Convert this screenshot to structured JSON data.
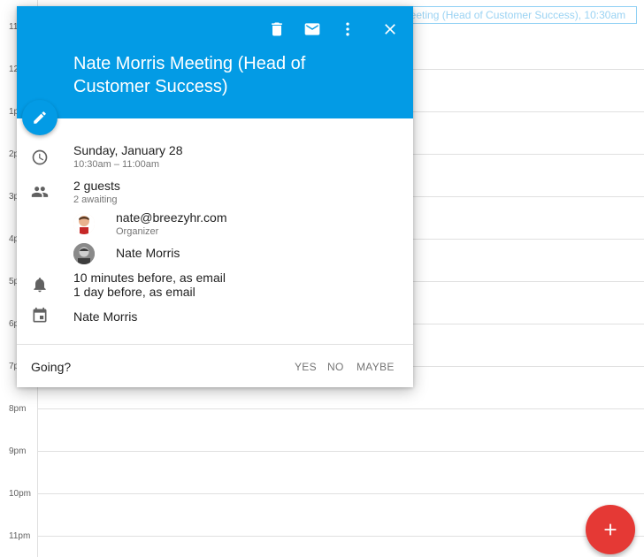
{
  "calendar": {
    "hours": [
      "11",
      "12",
      "1p",
      "2p",
      "3p",
      "4p",
      "5p",
      "6p",
      "7p",
      "8pm",
      "9pm",
      "10pm",
      "11pm"
    ],
    "event_chip": "leeting (Head of Customer Success), 10:30am"
  },
  "event": {
    "title": "Nate Morris Meeting (Head of Customer Success)",
    "date": "Sunday, January 28",
    "time": "10:30am – 11:00am",
    "guests_count": "2 guests",
    "guests_status": "2 awaiting",
    "guests": [
      {
        "name": "nate@breezyhr.com",
        "role": "Organizer"
      },
      {
        "name": "Nate Morris",
        "role": ""
      }
    ],
    "reminders": [
      "10 minutes before, as email",
      "1 day before, as email"
    ],
    "calendar_name": "Nate Morris"
  },
  "rsvp": {
    "question": "Going?",
    "yes": "YES",
    "no": "NO",
    "maybe": "MAYBE"
  },
  "icons": {
    "delete": "trash-icon",
    "email": "mail-icon",
    "more": "more-vert-icon",
    "close": "close-icon",
    "edit": "pencil-icon",
    "time": "clock-icon",
    "guests": "people-icon",
    "reminder": "bell-icon",
    "calendar": "calendar-icon",
    "create": "plus-icon"
  },
  "colors": {
    "header": "#039be5",
    "create_fab": "#e53935",
    "chip_border": "#8fd0f4"
  }
}
